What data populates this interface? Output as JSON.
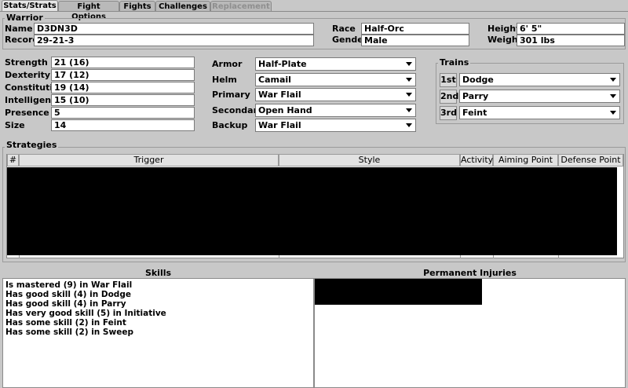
{
  "tabs": [
    {
      "label": "Stats/Strats"
    },
    {
      "label": "Fight Options"
    },
    {
      "label": "Fights"
    },
    {
      "label": "Challenges"
    },
    {
      "label": "Replacement"
    }
  ],
  "warrior": {
    "title": "Warrior",
    "name_label": "Name",
    "name": "D3DN3D",
    "record_label": "Record",
    "record": "29-21-3",
    "race_label": "Race",
    "race": "Half-Orc",
    "gender_label": "Gender",
    "gender": "Male",
    "height_label": "Height",
    "height": "6' 5\"",
    "weight_label": "Weight",
    "weight": "301 lbs"
  },
  "stats": [
    {
      "label": "Strength",
      "value": "21 (16)"
    },
    {
      "label": "Dexterity",
      "value": "17 (12)"
    },
    {
      "label": "Constitution",
      "value": "19 (14)"
    },
    {
      "label": "Intelligence",
      "value": "15 (10)"
    },
    {
      "label": "Presence",
      "value": "5"
    },
    {
      "label": "Size",
      "value": "14"
    }
  ],
  "equipment": [
    {
      "label": "Armor",
      "value": "Half-Plate"
    },
    {
      "label": "Helm",
      "value": "Camail"
    },
    {
      "label": "Primary",
      "value": "War Flail"
    },
    {
      "label": "Secondary",
      "value": "Open Hand"
    },
    {
      "label": "Backup",
      "value": "War Flail"
    }
  ],
  "trains": {
    "title": "Trains",
    "items": [
      {
        "order": "1st",
        "value": "Dodge"
      },
      {
        "order": "2nd",
        "value": "Parry"
      },
      {
        "order": "3rd",
        "value": "Feint"
      }
    ]
  },
  "strategies": {
    "title": "Strategies",
    "columns": [
      "#",
      "Trigger",
      "Style",
      "Activity",
      "Aiming Point",
      "Defense Point"
    ]
  },
  "skills": {
    "title": "Skills",
    "items": [
      "Is mastered (9) in War Flail",
      "Has good skill (4) in Dodge",
      "Has good skill (4) in Parry",
      "Has very good skill (5) in Initiative",
      "Has some skill (2) in Feint",
      "Has some skill (2) in Sweep"
    ]
  },
  "injuries": {
    "title": "Permanent Injuries"
  }
}
